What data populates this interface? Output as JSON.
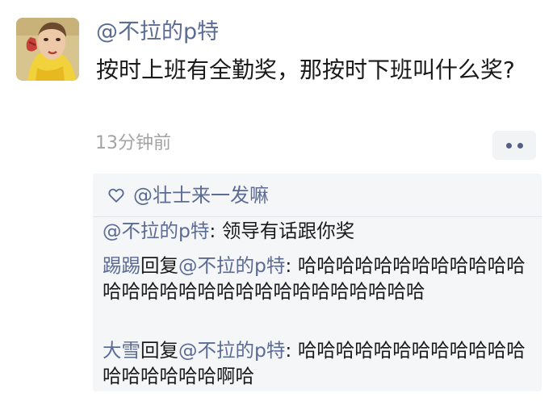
{
  "post": {
    "author": "@不拉的p特",
    "content": "按时上班有全勤奖，那按时下班叫什么奖?",
    "timestamp": "13分钟前",
    "more_icon": "more-dots-icon",
    "avatar_icon": "cartoon-avatar"
  },
  "likes": {
    "icon": "heart-icon",
    "users": "@壮士来一发嘛"
  },
  "comments": [
    {
      "author": "@不拉的p特",
      "separator": ": ",
      "text": "领导有话跟你奖"
    },
    {
      "author": "踢踢",
      "reply_word": "回复",
      "reply_to": "@不拉的p特",
      "separator": ": ",
      "text": "哈哈哈哈哈哈哈哈哈哈哈哈哈哈哈哈哈哈哈哈哈哈哈哈哈哈哈哈哈"
    },
    {
      "author": "大雪",
      "reply_word": "回复",
      "reply_to": "@不拉的p特",
      "separator": ": ",
      "text": "哈哈哈哈哈哈哈哈哈哈哈哈哈哈哈哈哈哈啊哈"
    }
  ],
  "colors": {
    "name": "#5b6b93",
    "text": "#1a1a1a",
    "muted": "#a3a3a3",
    "panel": "#f5f6f8"
  }
}
